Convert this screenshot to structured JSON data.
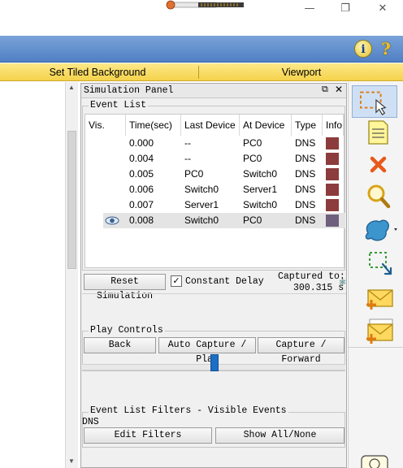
{
  "window": {
    "controls": {
      "minimize": "—",
      "restore": "❐",
      "close": "✕"
    }
  },
  "top_bar": {
    "info_icon": "i",
    "help_icon": "?"
  },
  "yellow_bar": {
    "background_btn": "Set Tiled Background",
    "viewport_btn": "Viewport"
  },
  "simulation_panel": {
    "title": "Simulation Panel",
    "title_controls": {
      "restore": "⧉",
      "close": "✕"
    },
    "event_list": {
      "label": "Event List",
      "columns": [
        "Vis.",
        "Time(sec)",
        "Last Device",
        "At Device",
        "Type",
        "Info"
      ],
      "rows": [
        {
          "time": "0.000",
          "last": "--",
          "at": "PC0",
          "type": "DNS",
          "color": "#8c3c3c",
          "selected": false
        },
        {
          "time": "0.004",
          "last": "--",
          "at": "PC0",
          "type": "DNS",
          "color": "#8c3c3c",
          "selected": false
        },
        {
          "time": "0.005",
          "last": "PC0",
          "at": "Switch0",
          "type": "DNS",
          "color": "#8c3c3c",
          "selected": false
        },
        {
          "time": "0.006",
          "last": "Switch0",
          "at": "Server1",
          "type": "DNS",
          "color": "#8c3c3c",
          "selected": false
        },
        {
          "time": "0.007",
          "last": "Server1",
          "at": "Switch0",
          "type": "DNS",
          "color": "#8c3c3c",
          "selected": false
        },
        {
          "time": "0.008",
          "last": "Switch0",
          "at": "PC0",
          "type": "DNS",
          "color": "#6e5f7e",
          "selected": true
        }
      ]
    },
    "reset_btn": "Reset Simulation",
    "constant_delay_label": "Constant Delay",
    "captured_label": "Captured to:",
    "captured_value": "300.315 s",
    "play_controls": {
      "label": "Play Controls",
      "back": "Back",
      "auto_capture": "Auto Capture / Play",
      "capture_forward": "Capture / Forward"
    },
    "filters": {
      "label": "Event List Filters - Visible Events",
      "value": "DNS",
      "edit": "Edit Filters",
      "show_all": "Show All/None"
    }
  },
  "colors": {
    "blue_bar": "#5d8bcb",
    "yellow_bar": "#f7d95a",
    "selected_row": "#e4e4e4",
    "slider": "#1c6fc4"
  }
}
